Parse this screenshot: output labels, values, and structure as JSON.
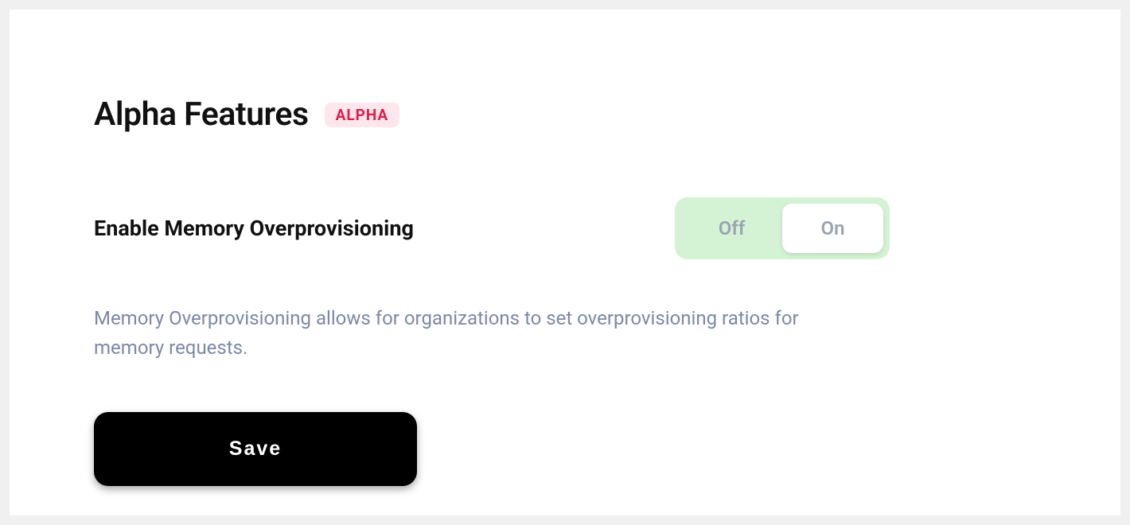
{
  "header": {
    "title": "Alpha Features",
    "badge": "ALPHA"
  },
  "setting": {
    "label": "Enable Memory Overprovisioning",
    "description": "Memory Overprovisioning allows for organizations to set overprovisioning ratios for memory requests.",
    "toggle": {
      "off_label": "Off",
      "on_label": "On",
      "value": "On"
    }
  },
  "actions": {
    "save_label": "Save"
  }
}
